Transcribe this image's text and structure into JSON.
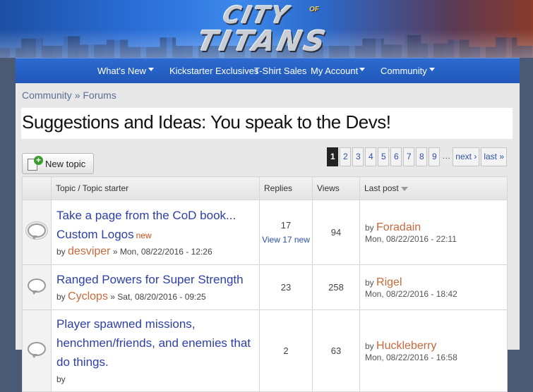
{
  "site": {
    "logo_line1": "CITY",
    "logo_of": "OF",
    "logo_line2": "TITANS"
  },
  "nav": [
    {
      "label": "What's New",
      "has_dropdown": true
    },
    {
      "label": "Kickstarter Exclusives",
      "has_dropdown": false
    },
    {
      "label": "T-Shirt Sales",
      "has_dropdown": false
    },
    {
      "label": "My Account",
      "has_dropdown": true
    },
    {
      "label": "Community",
      "has_dropdown": true
    }
  ],
  "breadcrumb": {
    "root": "Community",
    "sep": "»",
    "current": "Forums"
  },
  "page_title": "Suggestions and Ideas: You speak to the Devs!",
  "new_topic_label": "New topic",
  "pager": {
    "current": "1",
    "pages": [
      "2",
      "3",
      "4",
      "5",
      "6",
      "7",
      "8",
      "9"
    ],
    "dots": "…",
    "next": "next ›",
    "last": "last »"
  },
  "table": {
    "headers": {
      "topic": "Topic / Topic starter",
      "replies": "Replies",
      "views": "Views",
      "last_post": "Last post"
    },
    "rows": [
      {
        "title": "Take a page from the CoD book... Custom Logos",
        "new_label": "new",
        "by": "by",
        "author": "desviper",
        "date": "» Mon, 08/22/2016 - 12:26",
        "replies": "17",
        "replies_new": "View 17 new",
        "views": "94",
        "last_by": "by",
        "last_author": "Foradain",
        "last_date": "Mon, 08/22/2016 - 22:11",
        "icon": "hot-topic-icon"
      },
      {
        "title": "Ranged Powers for Super Strength",
        "by": "by",
        "author": "Cyclops",
        "date": "» Sat, 08/20/2016 - 09:25",
        "replies": "23",
        "views": "258",
        "last_by": "by",
        "last_author": "Rigel",
        "last_date": "Mon, 08/22/2016 - 18:42",
        "icon": "topic-icon"
      },
      {
        "title": "Player spawned missions, henchmen/friends, and enemies that do things.",
        "by": "by",
        "author": "",
        "date": "",
        "replies": "2",
        "views": "63",
        "last_by": "by",
        "last_author": "Huckleberry",
        "last_date": "Mon, 08/22/2016 - 16:58",
        "icon": "topic-icon"
      }
    ]
  },
  "colors": {
    "nav_bg": "#2d6ad0",
    "link": "#2c3fa6",
    "author": "#c8693c",
    "new_badge": "#d44a18"
  }
}
